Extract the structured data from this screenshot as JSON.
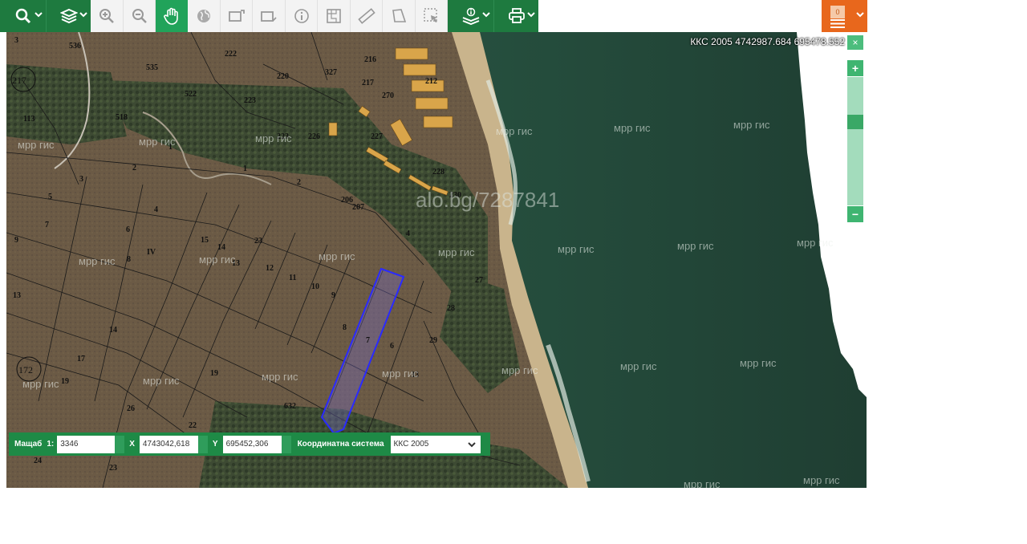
{
  "toolbar": {
    "buttons": [
      {
        "name": "search-tool",
        "icon": "search-icon",
        "dropdown": true
      },
      {
        "name": "layers-tool",
        "icon": "layers-icon",
        "dropdown": true
      },
      {
        "name": "zoom-in-tool",
        "icon": "zoom-in-icon"
      },
      {
        "name": "zoom-out-tool",
        "icon": "zoom-out-icon"
      },
      {
        "name": "pan-tool",
        "icon": "hand-icon",
        "active": true
      },
      {
        "name": "full-extent-tool",
        "icon": "globe-icon"
      },
      {
        "name": "zoom-to-selection-tool",
        "icon": "rect-zoom-icon"
      },
      {
        "name": "previous-extent-tool",
        "icon": "rect-back-icon"
      },
      {
        "name": "info-tool",
        "icon": "info-icon"
      },
      {
        "name": "map-sheet-tool",
        "icon": "sheet-icon"
      },
      {
        "name": "measure-distance-tool",
        "icon": "ruler-icon"
      },
      {
        "name": "measure-area-tool",
        "icon": "polygon-icon"
      },
      {
        "name": "select-tool",
        "icon": "select-icon"
      },
      {
        "name": "layer-info-tool",
        "icon": "layer-info-icon",
        "dropdown": true
      },
      {
        "name": "print-tool",
        "icon": "print-icon",
        "dropdown": true
      }
    ],
    "cart_count": "0"
  },
  "map": {
    "coord_readout": "ККС 2005 4742987.684  695478.552",
    "close_label": "×",
    "watermark_main": "alo.bg/7287841",
    "watermark_text": "мрр гис",
    "zoom_plus": "+",
    "zoom_minus": "−",
    "zoom_level": 0.33,
    "parcel_ids": [
      "536",
      "535",
      "522",
      "518",
      "222",
      "220",
      "223",
      "226",
      "227",
      "228",
      "230",
      "327",
      "217",
      "270",
      "212",
      "216",
      "2",
      "3",
      "5",
      "7",
      "9",
      "13",
      "14",
      "17",
      "19",
      "26",
      "22",
      "24",
      "23",
      "1",
      "2",
      "4",
      "6",
      "8",
      "IV",
      "15",
      "14",
      "13",
      "12",
      "11",
      "10",
      "9",
      "8",
      "7",
      "6",
      "206",
      "207",
      "4",
      "27",
      "28",
      "29",
      "33",
      "632",
      "172",
      "217"
    ],
    "district_labels": [
      "172",
      "217"
    ]
  },
  "coord_bar": {
    "scale_label": "Мащаб",
    "scale_prefix": "1:",
    "scale_value": "3346",
    "x_label": "X",
    "x_value": "4743042,618",
    "y_label": "Y",
    "y_value": "695452,306",
    "system_label": "Координатна система",
    "system_value": "ККС 2005"
  },
  "colors": {
    "toolbar_green": "#1e7a3f",
    "active_green": "#21a35a",
    "orange": "#e8671c",
    "parcel_highlight": "#2a2aff"
  }
}
